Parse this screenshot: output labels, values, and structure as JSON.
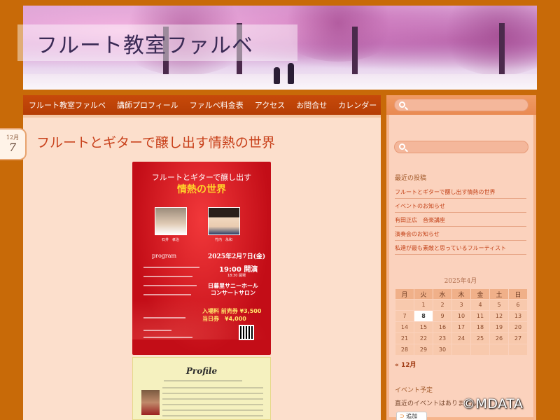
{
  "site": {
    "title": "フルート教室ファルベ"
  },
  "nav": {
    "items": [
      "フルート教室ファルベ",
      "講師プロフィール",
      "ファルベ料金表",
      "アクセス",
      "お問合せ",
      "カレンダー"
    ]
  },
  "post": {
    "month": "12月",
    "day": "7",
    "title": "フルートとギターで醸し出す情熱の世界"
  },
  "poster": {
    "subtitle": "フルートとギターで醸し出す",
    "headline": "情熱の世界",
    "performer1": "石井　孝治",
    "performer2": "竹内　永和",
    "program_label": "program",
    "date": "2025年2月7日(金)",
    "time": "19:00 開演",
    "doors": "18:30 開場",
    "venue": "日暮里サニーホール コンサートサロン",
    "price_advance": "入場料 前売券 ¥3,500",
    "price_door": "当日券　¥4,000"
  },
  "profile": {
    "title": "Profile"
  },
  "sidebar": {
    "recent_heading": "最近の投稿",
    "recent_posts": [
      "フルートとギターで醸し出す情熱の世界",
      "イベントのお知らせ",
      "有田正広　音楽講座",
      "演奏会のお知らせ",
      "私達が最も素敵と思っているフルーティスト"
    ],
    "calendar": {
      "caption": "2025年4月",
      "weekdays": [
        "月",
        "火",
        "水",
        "木",
        "金",
        "土",
        "日"
      ],
      "weeks": [
        [
          "",
          "1",
          "2",
          "3",
          "4",
          "5",
          "6"
        ],
        [
          "7",
          "8",
          "9",
          "10",
          "11",
          "12",
          "13"
        ],
        [
          "14",
          "15",
          "16",
          "17",
          "18",
          "19",
          "20"
        ],
        [
          "21",
          "22",
          "23",
          "24",
          "25",
          "26",
          "27"
        ],
        [
          "28",
          "29",
          "30",
          "",
          "",
          "",
          ""
        ]
      ],
      "today": "8",
      "prev_link": "« 12月"
    },
    "events_heading": "イベント予定",
    "events_text": "直近のイベントはありません。",
    "add_button": "追加"
  },
  "watermark": "©MDATA",
  "colors": {
    "page_bg": "#c86a08",
    "nav_bg": "#c74a0a",
    "content_bg": "#fcdfcc",
    "sidebar_bg": "#fbd2bd",
    "link": "#c4451c",
    "title": "#c8401a"
  }
}
